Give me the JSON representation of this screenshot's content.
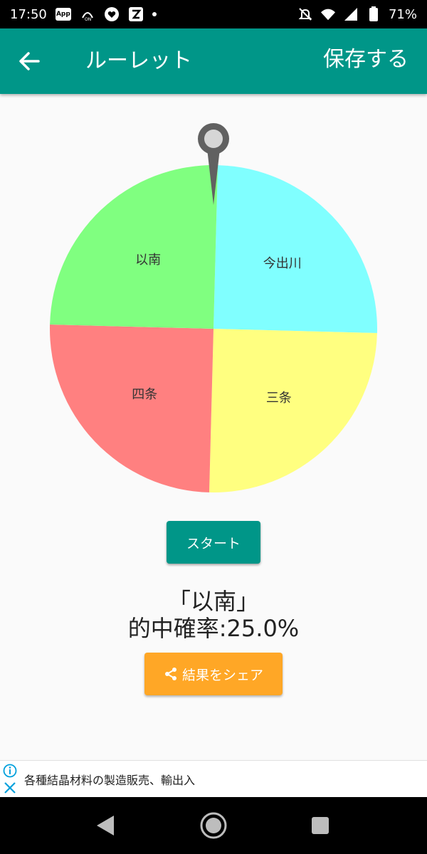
{
  "status_bar": {
    "time": "17:50",
    "app_icon_label": "App",
    "battery": "71%",
    "icons": [
      "app-icon",
      "nfc-icon",
      "heart-icon",
      "s-icon",
      "dot-icon",
      "mute-icon",
      "wifi-icon",
      "signal-icon",
      "battery-icon"
    ]
  },
  "app_bar": {
    "title": "ルーレット",
    "save_label": "保存する",
    "color": "#009688"
  },
  "roulette": {
    "segments": [
      {
        "label": "今出川",
        "value": 25,
        "color": "#80ffff"
      },
      {
        "label": "三条",
        "value": 25,
        "color": "#ffff80"
      },
      {
        "label": "四条",
        "value": 25,
        "color": "#ff8080"
      },
      {
        "label": "以南",
        "value": 25,
        "color": "#80ff80"
      }
    ],
    "pointer_color": "#616161"
  },
  "start_label": "スタート",
  "result": {
    "selected": "「以南」",
    "probability": "的中確率:25.0%"
  },
  "share_label": "結果をシェア",
  "share_color": "#ffa726",
  "ad": {
    "text": "各種結晶材料の製造販売、輸出入",
    "accent": "#00a0dc"
  }
}
